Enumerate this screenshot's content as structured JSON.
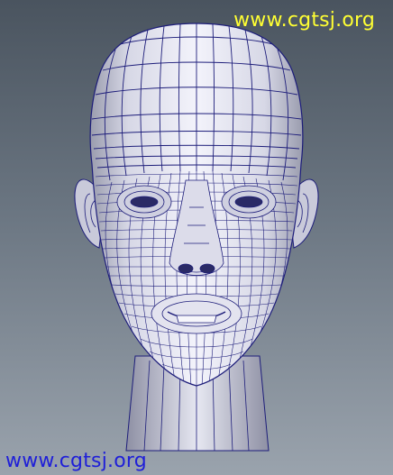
{
  "watermarks": {
    "top_right": "www.cgtsj.org",
    "bottom_left": "www.cgtsj.org"
  },
  "colors": {
    "viewport_top": "#4a545f",
    "viewport_bottom": "#9aa3ad",
    "mesh_fill": "#d7d8e6",
    "mesh_wire": "#1d1d7a",
    "watermark_top": "#ffff33",
    "watermark_bottom": "#1f1fd8"
  },
  "viewport": {
    "subject": "wireframe-head-mesh"
  }
}
